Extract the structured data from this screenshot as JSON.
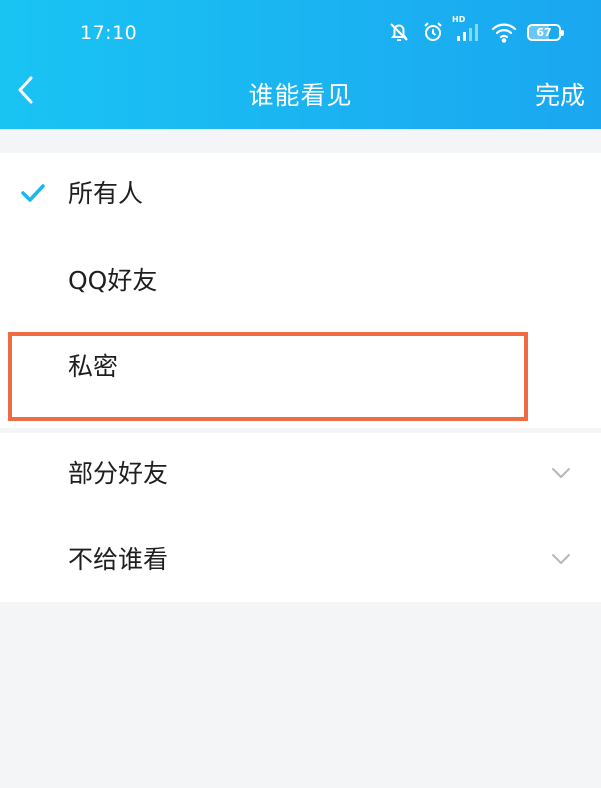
{
  "status_bar": {
    "time": "17:10",
    "network_label": "HD",
    "battery": "67",
    "battery_level": 0.67
  },
  "nav": {
    "title": "谁能看见",
    "done_label": "完成"
  },
  "options": [
    {
      "label": "所有人",
      "selected": true
    },
    {
      "label": "QQ好友",
      "selected": false
    },
    {
      "label": "私密",
      "selected": false,
      "highlighted": true
    }
  ],
  "expandable_options": [
    {
      "label": "部分好友"
    },
    {
      "label": "不给谁看"
    }
  ],
  "colors": {
    "header_gradient_start": "#19c4f3",
    "header_gradient_end": "#1aa7f0",
    "check": "#1cb7ee",
    "highlight_border": "#ee6b43"
  },
  "icons": {
    "back": "chevron-left-icon",
    "check": "check-icon",
    "expand": "chevron-down-icon"
  }
}
